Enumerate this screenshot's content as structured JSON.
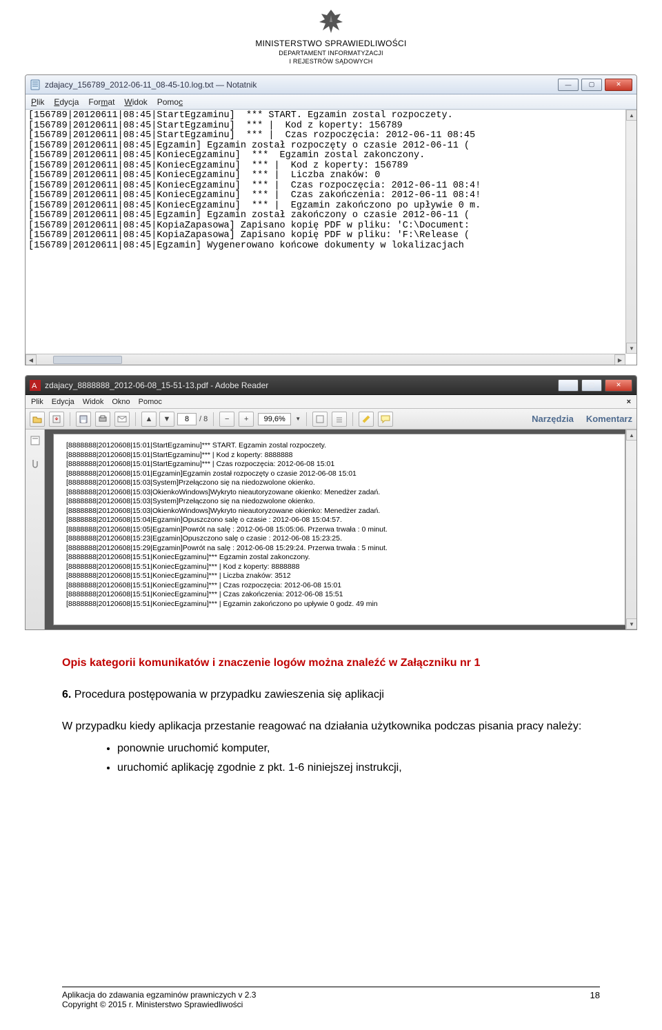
{
  "header": {
    "ministry": "MINISTERSTWO SPRAWIEDLIWOŚCI",
    "dept1": "DEPARTAMENT INFORMATYZACJI",
    "dept2": "I REJESTRÓW SĄDOWYCH"
  },
  "notepad": {
    "title": "zdajacy_156789_2012-06-11_08-45-10.log.txt — Notatnik",
    "menu": {
      "plik": "Plik",
      "edycja": "Edycja",
      "format": "Format",
      "widok": "Widok",
      "pomoc": "Pomoc"
    },
    "lines": [
      "[156789|20120611|08:45|StartEgzaminu]  *** START. Egzamin zostal rozpoczety.",
      "[156789|20120611|08:45|StartEgzaminu]  *** |  Kod z koperty: 156789",
      "[156789|20120611|08:45|StartEgzaminu]  *** |  Czas rozpoczęcia: 2012-06-11 08:45",
      "[156789|20120611|08:45|Egzamin] Egzamin został rozpoczęty o czasie 2012-06-11 (",
      "[156789|20120611|08:45|KoniecEgzaminu]  ***  Egzamin zostal zakonczony.",
      "[156789|20120611|08:45|KoniecEgzaminu]  *** |  Kod z koperty: 156789",
      "[156789|20120611|08:45|KoniecEgzaminu]  *** |  Liczba znaków: 0",
      "[156789|20120611|08:45|KoniecEgzaminu]  *** |  Czas rozpoczęcia: 2012-06-11 08:4!",
      "[156789|20120611|08:45|KoniecEgzaminu]  *** |  Czas zakończenia: 2012-06-11 08:4!",
      "[156789|20120611|08:45|KoniecEgzaminu]  *** |  Egzamin zakończono po upływie 0 m.",
      "[156789|20120611|08:45|Egzamin] Egzamin został zakończony o czasie 2012-06-11 (",
      "[156789|20120611|08:45|KopiaZapasowa] Zapisano kopię PDF w pliku: 'C:\\Document:",
      "[156789|20120611|08:45|KopiaZapasowa] Zapisano kopię PDF w pliku: 'F:\\Release (",
      "[156789|20120611|08:45|Egzamin] Wygenerowano końcowe dokumenty w lokalizacjach"
    ]
  },
  "pdf": {
    "title": "zdajacy_8888888_2012-06-08_15-51-13.pdf - Adobe Reader",
    "menu": {
      "plik": "Plik",
      "edycja": "Edycja",
      "widok": "Widok",
      "okno": "Okno",
      "pomoc": "Pomoc"
    },
    "page_current": "8",
    "page_total": "/ 8",
    "zoom": "99,6%",
    "tab_tools": "Narzędzia",
    "tab_comment": "Komentarz",
    "lines": [
      "[8888888|20120608|15:01|StartEgzaminu]*** START. Egzamin zostal rozpoczety.",
      "[8888888|20120608|15:01|StartEgzaminu]*** | Kod z koperty: 8888888",
      "[8888888|20120608|15:01|StartEgzaminu]*** | Czas rozpoczęcia: 2012-06-08 15:01",
      "[8888888|20120608|15:01|Egzamin]Egzamin został rozpoczęty o czasie 2012-06-08 15:01",
      "[8888888|20120608|15:03|System]Przełączono się na niedozwolone okienko.",
      "[8888888|20120608|15:03|OkienkoWindows]Wykryto nieautoryzowane okienko: Menedżer zadań.",
      "[8888888|20120608|15:03|System]Przełączono się na niedozwolone okienko.",
      "[8888888|20120608|15:03|OkienkoWindows]Wykryto nieautoryzowane okienko: Menedżer zadań.",
      "[8888888|20120608|15:04|Egzamin]Opuszczono salę o czasie : 2012-06-08 15:04:57.",
      "[8888888|20120608|15:05|Egzamin]Powrót na salę : 2012-06-08 15:05:06. Przerwa trwała : 0 minut.",
      "[8888888|20120608|15:23|Egzamin]Opuszczono salę o czasie : 2012-06-08 15:23:25.",
      "[8888888|20120608|15:29|Egzamin]Powrót na salę : 2012-06-08 15:29:24. Przerwa trwała : 5 minut.",
      "[8888888|20120608|15:51|KoniecEgzaminu]*** Egzamin zostal zakonczony.",
      "[8888888|20120608|15:51|KoniecEgzaminu]*** | Kod z koperty: 8888888",
      "[8888888|20120608|15:51|KoniecEgzaminu]*** | Liczba znaków: 3512",
      "[8888888|20120608|15:51|KoniecEgzaminu]*** | Czas rozpoczęcia: 2012-06-08 15:01",
      "[8888888|20120608|15:51|KoniecEgzaminu]*** | Czas zakończenia: 2012-06-08 15:51",
      "[8888888|20120608|15:51|KoniecEgzaminu]*** | Egzamin zakończono po upływie 0 godz. 49 min"
    ]
  },
  "body": {
    "caption": "Opis kategorii komunikatów i znaczenie logów można znaleźć w Załączniku nr 1",
    "section_num": "6.",
    "section_title": "Procedura postępowania w przypadku zawieszenia się aplikacji",
    "para": "W przypadku kiedy aplikacja przestanie reagować na działania użytkownika podczas pisania pracy należy:",
    "bullet1": "ponownie uruchomić komputer,",
    "bullet2": "uruchomić aplikację zgodnie z pkt. 1-6 niniejszej instrukcji,"
  },
  "footer": {
    "line1": "Aplikacja do zdawania egzaminów prawniczych v 2.3",
    "line2": "Copyright © 2015 r. Ministerstwo Sprawiedliwości",
    "page": "18"
  }
}
